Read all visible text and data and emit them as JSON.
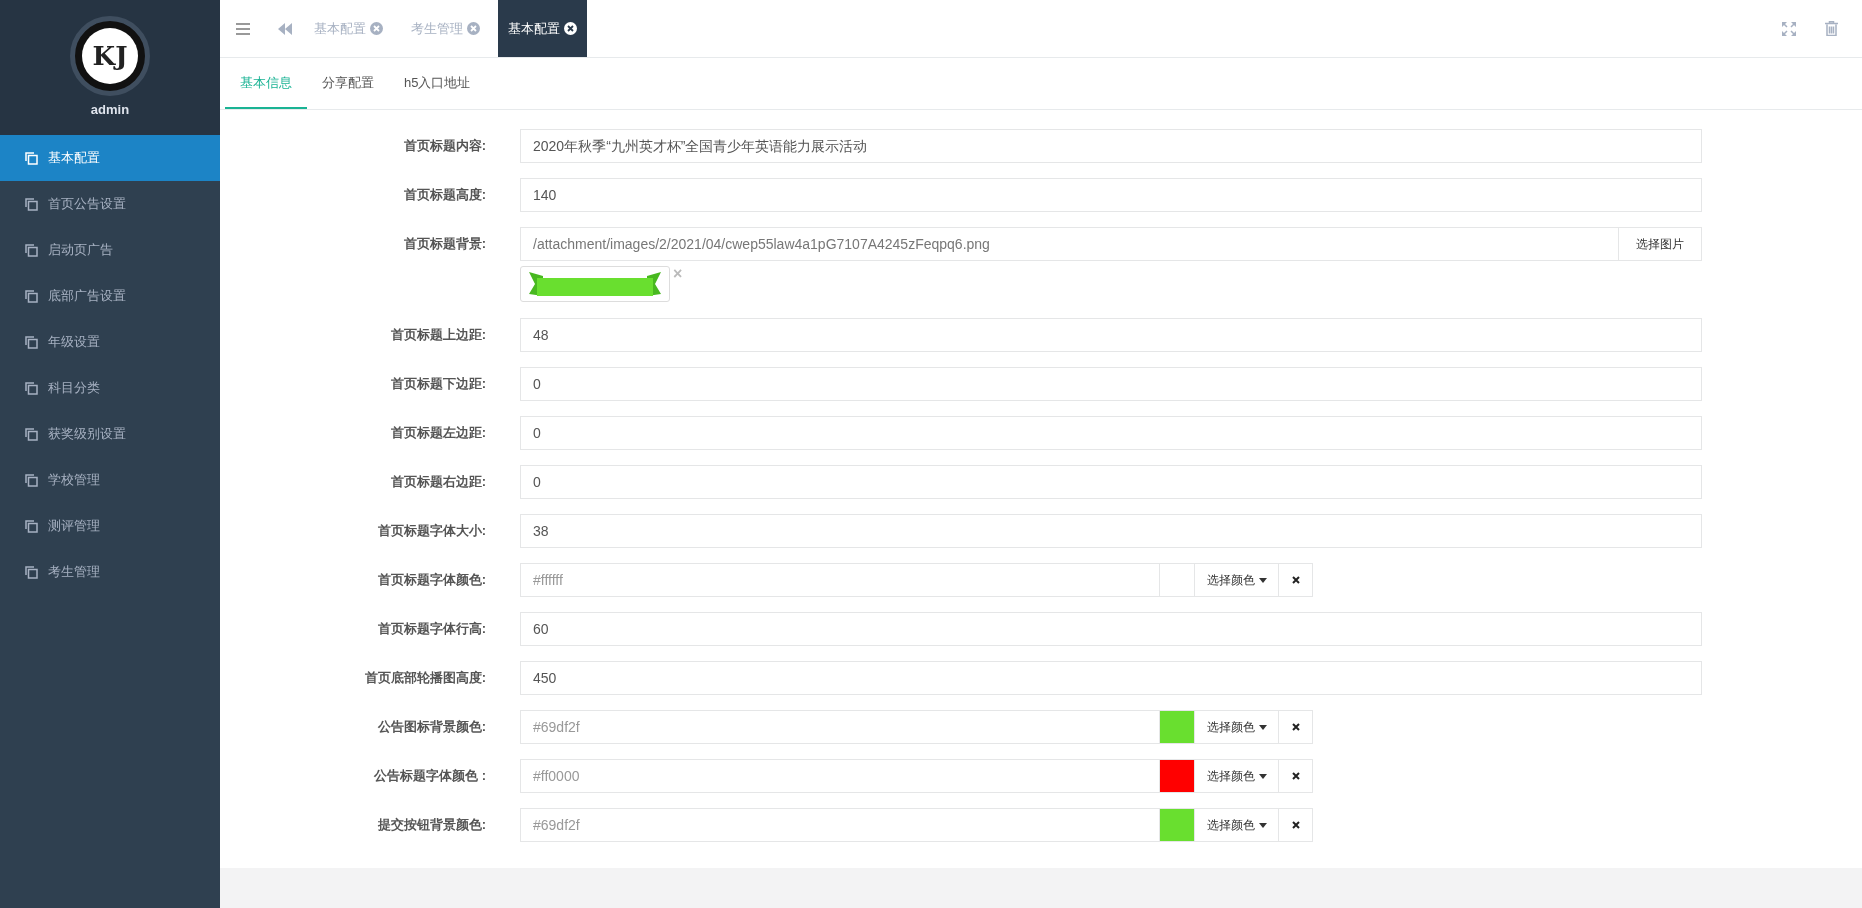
{
  "sidebar": {
    "logo": "KJ",
    "user": "admin",
    "items": [
      {
        "label": "基本配置",
        "selected": true
      },
      {
        "label": "首页公告设置",
        "selected": false
      },
      {
        "label": "启动页广告",
        "selected": false
      },
      {
        "label": "底部广告设置",
        "selected": false
      },
      {
        "label": "年级设置",
        "selected": false
      },
      {
        "label": "科目分类",
        "selected": false
      },
      {
        "label": "获奖级别设置",
        "selected": false
      },
      {
        "label": "学校管理",
        "selected": false
      },
      {
        "label": "测评管理",
        "selected": false
      },
      {
        "label": "考生管理",
        "selected": false
      }
    ]
  },
  "page_tabs": [
    {
      "label": "基本配置",
      "selected": false
    },
    {
      "label": "考生管理",
      "selected": false
    },
    {
      "label": "基本配置",
      "selected": true
    }
  ],
  "sub_tabs": [
    {
      "label": "基本信息",
      "selected": true
    },
    {
      "label": "分享配置",
      "selected": false
    },
    {
      "label": "h5入口地址",
      "selected": false
    }
  ],
  "form": [
    {
      "kind": "text",
      "label": "首页标题内容:",
      "value": "2020年秋季“九州英才杯”全国青少年英语能力展示活动"
    },
    {
      "kind": "text",
      "label": "首页标题高度:",
      "value": "140"
    },
    {
      "kind": "image",
      "label": "首页标题背景:",
      "value": "/attachment/images/2/2021/04/cwep55law4a1pG7107A4245zFeqpq6.png",
      "button": "选择图片",
      "remove": "×"
    },
    {
      "kind": "text",
      "label": "首页标题上边距:",
      "value": "48"
    },
    {
      "kind": "text",
      "label": "首页标题下边距:",
      "value": "0"
    },
    {
      "kind": "text",
      "label": "首页标题左边距:",
      "value": "0"
    },
    {
      "kind": "text",
      "label": "首页标题右边距:",
      "value": "0"
    },
    {
      "kind": "text",
      "label": "首页标题字体大小:",
      "value": "38"
    },
    {
      "kind": "color",
      "label": "首页标题字体颜色:",
      "value": "#ffffff",
      "color": "#ffffff",
      "button": "选择颜色"
    },
    {
      "kind": "text",
      "label": "首页标题字体行高:",
      "value": "60"
    },
    {
      "kind": "text",
      "label": "首页底部轮播图高度:",
      "value": "450"
    },
    {
      "kind": "color",
      "label": "公告图标背景颜色:",
      "value": "#69df2f",
      "color": "#69df2f",
      "button": "选择颜色"
    },
    {
      "kind": "color",
      "label": "公告标题字体颜色 :",
      "value": "#ff0000",
      "color": "#ff0000",
      "button": "选择颜色"
    },
    {
      "kind": "color",
      "label": "提交按钮背景颜色:",
      "value": "#69df2f",
      "color": "#69df2f",
      "button": "选择颜色"
    }
  ]
}
